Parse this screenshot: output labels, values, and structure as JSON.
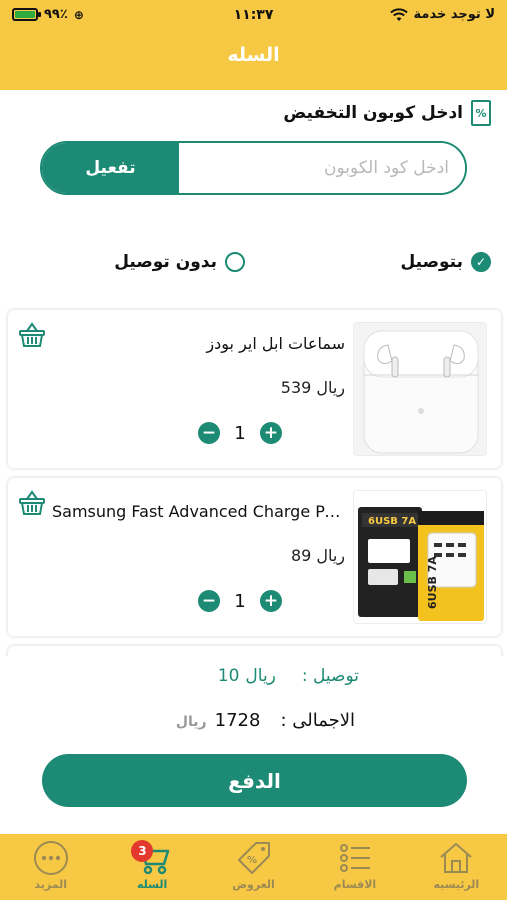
{
  "status_bar": {
    "battery_percent": "٩٩٪",
    "time": "١١:٣٧",
    "carrier": "لا توجد خدمة",
    "battery_level": 0.9
  },
  "header": {
    "title": "السله"
  },
  "coupon": {
    "label": "ادخل كوبون التخفيض",
    "icon": "discount-tag-icon",
    "placeholder": "ادخل كود الكوبون",
    "value": "",
    "activate_label": "تفعيل"
  },
  "delivery_options": {
    "with_delivery": {
      "label": "بتوصيل",
      "checked": true
    },
    "without_delivery": {
      "label": "بدون توصيل",
      "checked": false
    }
  },
  "cart": {
    "items": [
      {
        "name": "سماعات ابل اير بودز",
        "price": "539",
        "currency": "ريال",
        "quantity": "1",
        "image": "airpods"
      },
      {
        "name": "Samsung Fast Advanced Charge Po...",
        "price": "89",
        "currency": "ريال",
        "quantity": "1",
        "image": "usb-charger"
      }
    ],
    "minus": "−",
    "plus": "+"
  },
  "summary": {
    "delivery_label": "توصيل :",
    "delivery_value": "10",
    "delivery_currency": "ريال",
    "total_label": "الاجمالى :",
    "total_value": "1728",
    "total_currency": "ريال",
    "pay_label": "الدفع"
  },
  "tabbar": {
    "tabs": [
      {
        "label": "الرئيسيه",
        "icon": "home-icon",
        "active": false
      },
      {
        "label": "الاقسام",
        "icon": "categories-list-icon",
        "active": false
      },
      {
        "label": "العروض",
        "icon": "offers-tag-icon",
        "active": false
      },
      {
        "label": "السله",
        "icon": "cart-icon",
        "active": true,
        "badge": "3"
      },
      {
        "label": "المزيد",
        "icon": "more-dots-icon",
        "active": false
      }
    ]
  },
  "colors": {
    "primary": "#1c8a74",
    "header": "#f7c843",
    "badge": "#e2382e"
  }
}
